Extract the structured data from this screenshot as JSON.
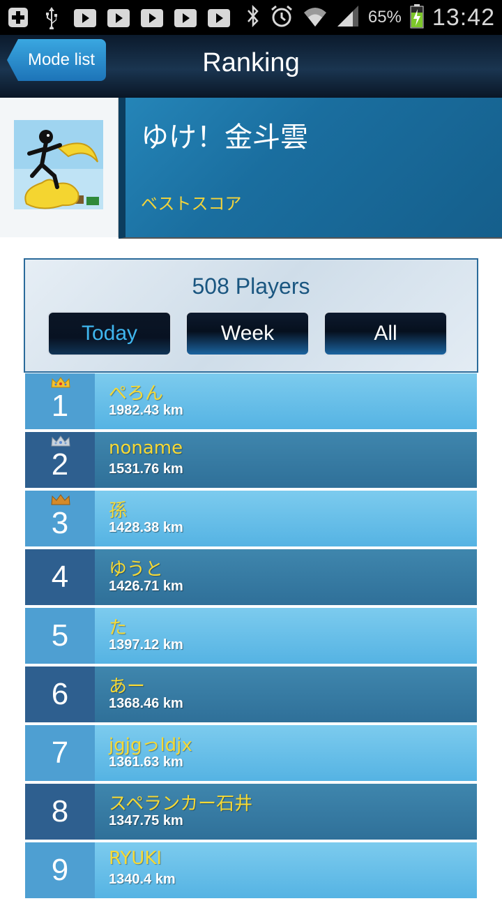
{
  "status_bar": {
    "icons": [
      "add-icon",
      "usb-icon",
      "play-icon",
      "play-icon",
      "play-icon",
      "play-icon",
      "play-icon"
    ],
    "right_icons": [
      "bluetooth-icon",
      "alarm-icon",
      "wifi-icon",
      "signal-icon"
    ],
    "battery_pct": "65%",
    "time": "13:42"
  },
  "header": {
    "back_label": "Mode list",
    "title": "Ranking"
  },
  "game": {
    "title": "ゆけ！金斗雲",
    "subtitle": "ベストスコア"
  },
  "filter": {
    "players": "508 Players",
    "tabs": [
      {
        "label": "Today",
        "active": true
      },
      {
        "label": "Week",
        "active": false
      },
      {
        "label": "All",
        "active": false
      }
    ]
  },
  "colors": {
    "gold_crown": "#f2c12e",
    "silver_crown": "#c8d2dc",
    "bronze_crown": "#d48a2a",
    "name_yellow": "#f6d935"
  },
  "ranking": [
    {
      "rank": "1",
      "name": "ぺろん",
      "score": "1982.43 km",
      "crown": "gold"
    },
    {
      "rank": "2",
      "name": "noname",
      "score": "1531.76 km",
      "crown": "silver"
    },
    {
      "rank": "3",
      "name": "孫",
      "score": "1428.38 km",
      "crown": "bronze"
    },
    {
      "rank": "4",
      "name": "ゆうと",
      "score": "1426.71 km",
      "crown": ""
    },
    {
      "rank": "5",
      "name": "た",
      "score": "1397.12 km",
      "crown": ""
    },
    {
      "rank": "6",
      "name": "あー",
      "score": "1368.46 km",
      "crown": ""
    },
    {
      "rank": "7",
      "name": "jgjgっldjx",
      "score": "1361.63 km",
      "crown": ""
    },
    {
      "rank": "8",
      "name": "スペランカー石井",
      "score": "1347.75 km",
      "crown": ""
    },
    {
      "rank": "9",
      "name": "RYUKI",
      "score": "1340.4 km",
      "crown": ""
    }
  ]
}
